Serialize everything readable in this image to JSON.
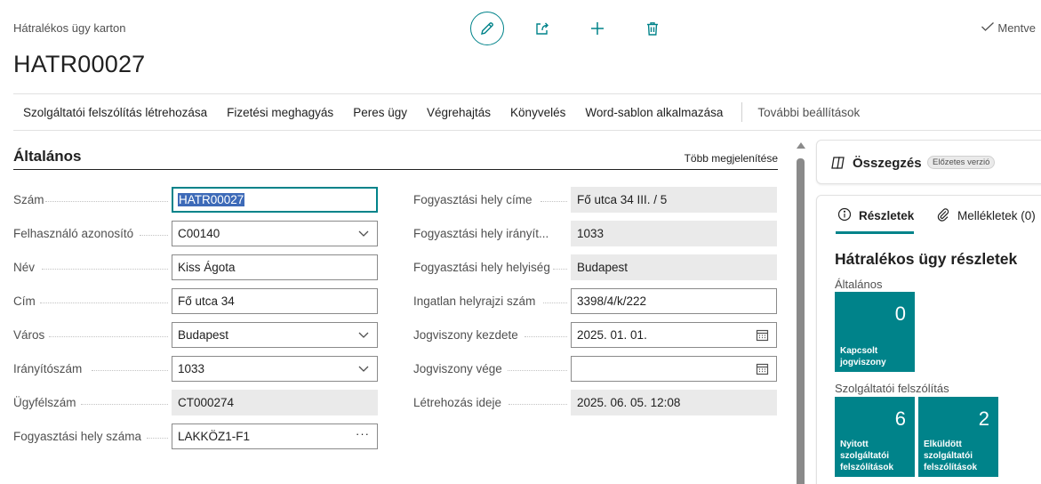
{
  "header": {
    "breadcrumb": "Hátralékos ügy karton",
    "title": "HATR00027",
    "saved_status": "Mentve"
  },
  "toolbar": {
    "icons": [
      "edit-icon",
      "share-icon",
      "add-icon",
      "delete-icon"
    ]
  },
  "actions": {
    "items": [
      "Szolgáltatói felszólítás létrehozása",
      "Fizetési meghagyás",
      "Peres ügy",
      "Végrehajtás",
      "Könyvelés",
      "Word-sablon alkalmazása"
    ],
    "more": "További beállítások"
  },
  "general": {
    "title": "Általános",
    "show_more": "Több megjelenítése",
    "left_fields": [
      {
        "label": "Szám",
        "value": "HATR00027"
      },
      {
        "label": "Felhasználó azonosító",
        "value": "C00140"
      },
      {
        "label": "Név",
        "value": "Kiss Ágota"
      },
      {
        "label": "Cím",
        "value": "Fő utca 34"
      },
      {
        "label": "Város",
        "value": "Budapest"
      },
      {
        "label": "Irányítószám",
        "value": "1033"
      },
      {
        "label": "Ügyfélszám",
        "value": "CT000274"
      },
      {
        "label": "Fogyasztási hely száma",
        "value": "LAKKÖZ1-F1"
      }
    ],
    "right_fields": [
      {
        "label": "Fogyasztási hely címe",
        "value": "Fő utca 34 III. / 5"
      },
      {
        "label": "Fogyasztási hely irányít...",
        "value": "1033"
      },
      {
        "label": "Fogyasztási hely helyiség",
        "value": "Budapest"
      },
      {
        "label": "Ingatlan helyrajzi szám",
        "value": "3398/4/k/222"
      },
      {
        "label": "Jogviszony kezdete",
        "value": "2025. 01. 01."
      },
      {
        "label": "Jogviszony vége",
        "value": ""
      },
      {
        "label": "Létrehozás ideje",
        "value": "2025. 06. 05. 12:08"
      }
    ]
  },
  "summary": {
    "title": "Összegzés",
    "badge": "Előzetes verzió"
  },
  "details": {
    "tabs": [
      "Részletek",
      "Mellékletek (0)"
    ],
    "title": "Hátralékos ügy részletek",
    "groups": [
      {
        "label": "Általános",
        "tiles": [
          {
            "value": "0",
            "label": "Kapcsolt jogviszony"
          }
        ]
      },
      {
        "label": "Szolgáltatói felszólítás",
        "tiles": [
          {
            "value": "6",
            "label": "Nyitott szolgáltatói felszólítások"
          },
          {
            "value": "2",
            "label": "Elküldött szolgáltatói felszólítások"
          }
        ]
      }
    ]
  },
  "colors": {
    "accent": "#00838a",
    "selection": "#3d6ab8",
    "readonly_bg": "#eaeaea"
  }
}
